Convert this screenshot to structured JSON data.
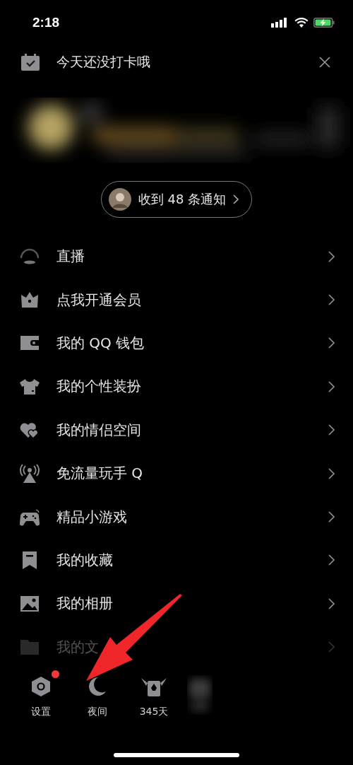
{
  "status_bar": {
    "time": "2:18",
    "charging": true
  },
  "checkin": {
    "text": "今天还没打卡哦"
  },
  "notifications": {
    "text": "收到 48 条通知"
  },
  "menu": [
    {
      "label": "直播",
      "faded": false
    },
    {
      "label": "点我开通会员",
      "faded": false
    },
    {
      "label": "我的 QQ 钱包",
      "faded": false
    },
    {
      "label": "我的个性装扮",
      "faded": false
    },
    {
      "label": "我的情侣空间",
      "faded": false
    },
    {
      "label": "免流量玩手 Q",
      "faded": false
    },
    {
      "label": "精品小游戏",
      "faded": false
    },
    {
      "label": "我的收藏",
      "faded": false
    },
    {
      "label": "我的相册",
      "faded": false
    },
    {
      "label": "我的文",
      "faded": true
    }
  ],
  "bottom_bar": [
    {
      "kind": "settings",
      "label": "设置",
      "badge": true
    },
    {
      "kind": "night",
      "label": "夜间",
      "badge": false
    },
    {
      "kind": "level",
      "label": "345天",
      "badge": false
    },
    {
      "kind": "blurred"
    }
  ]
}
